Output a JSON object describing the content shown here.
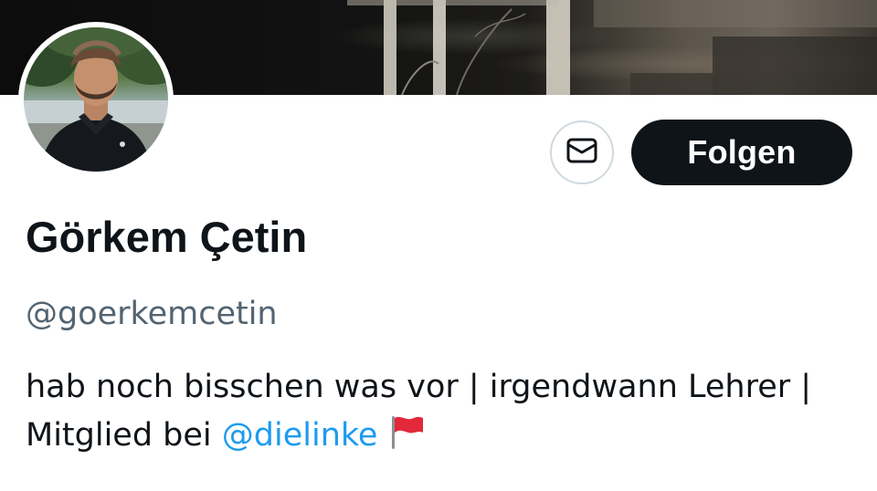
{
  "profile": {
    "display_name": "Görkem Çetin",
    "handle": "@goerkemcetin",
    "bio": {
      "line1": "hab noch bisschen was vor | irgendwann Lehrer |",
      "line2_prefix": "Mitglied bei ",
      "mention": "@dielinke",
      "emoji": "red-flag-icon"
    }
  },
  "actions": {
    "message_icon": "envelope-icon",
    "follow_label": "Folgen"
  },
  "colors": {
    "text_primary": "#0f1419",
    "text_secondary": "#536471",
    "link": "#1d9bf0",
    "follow_bg": "#0f1419",
    "border": "#cfd9de"
  }
}
